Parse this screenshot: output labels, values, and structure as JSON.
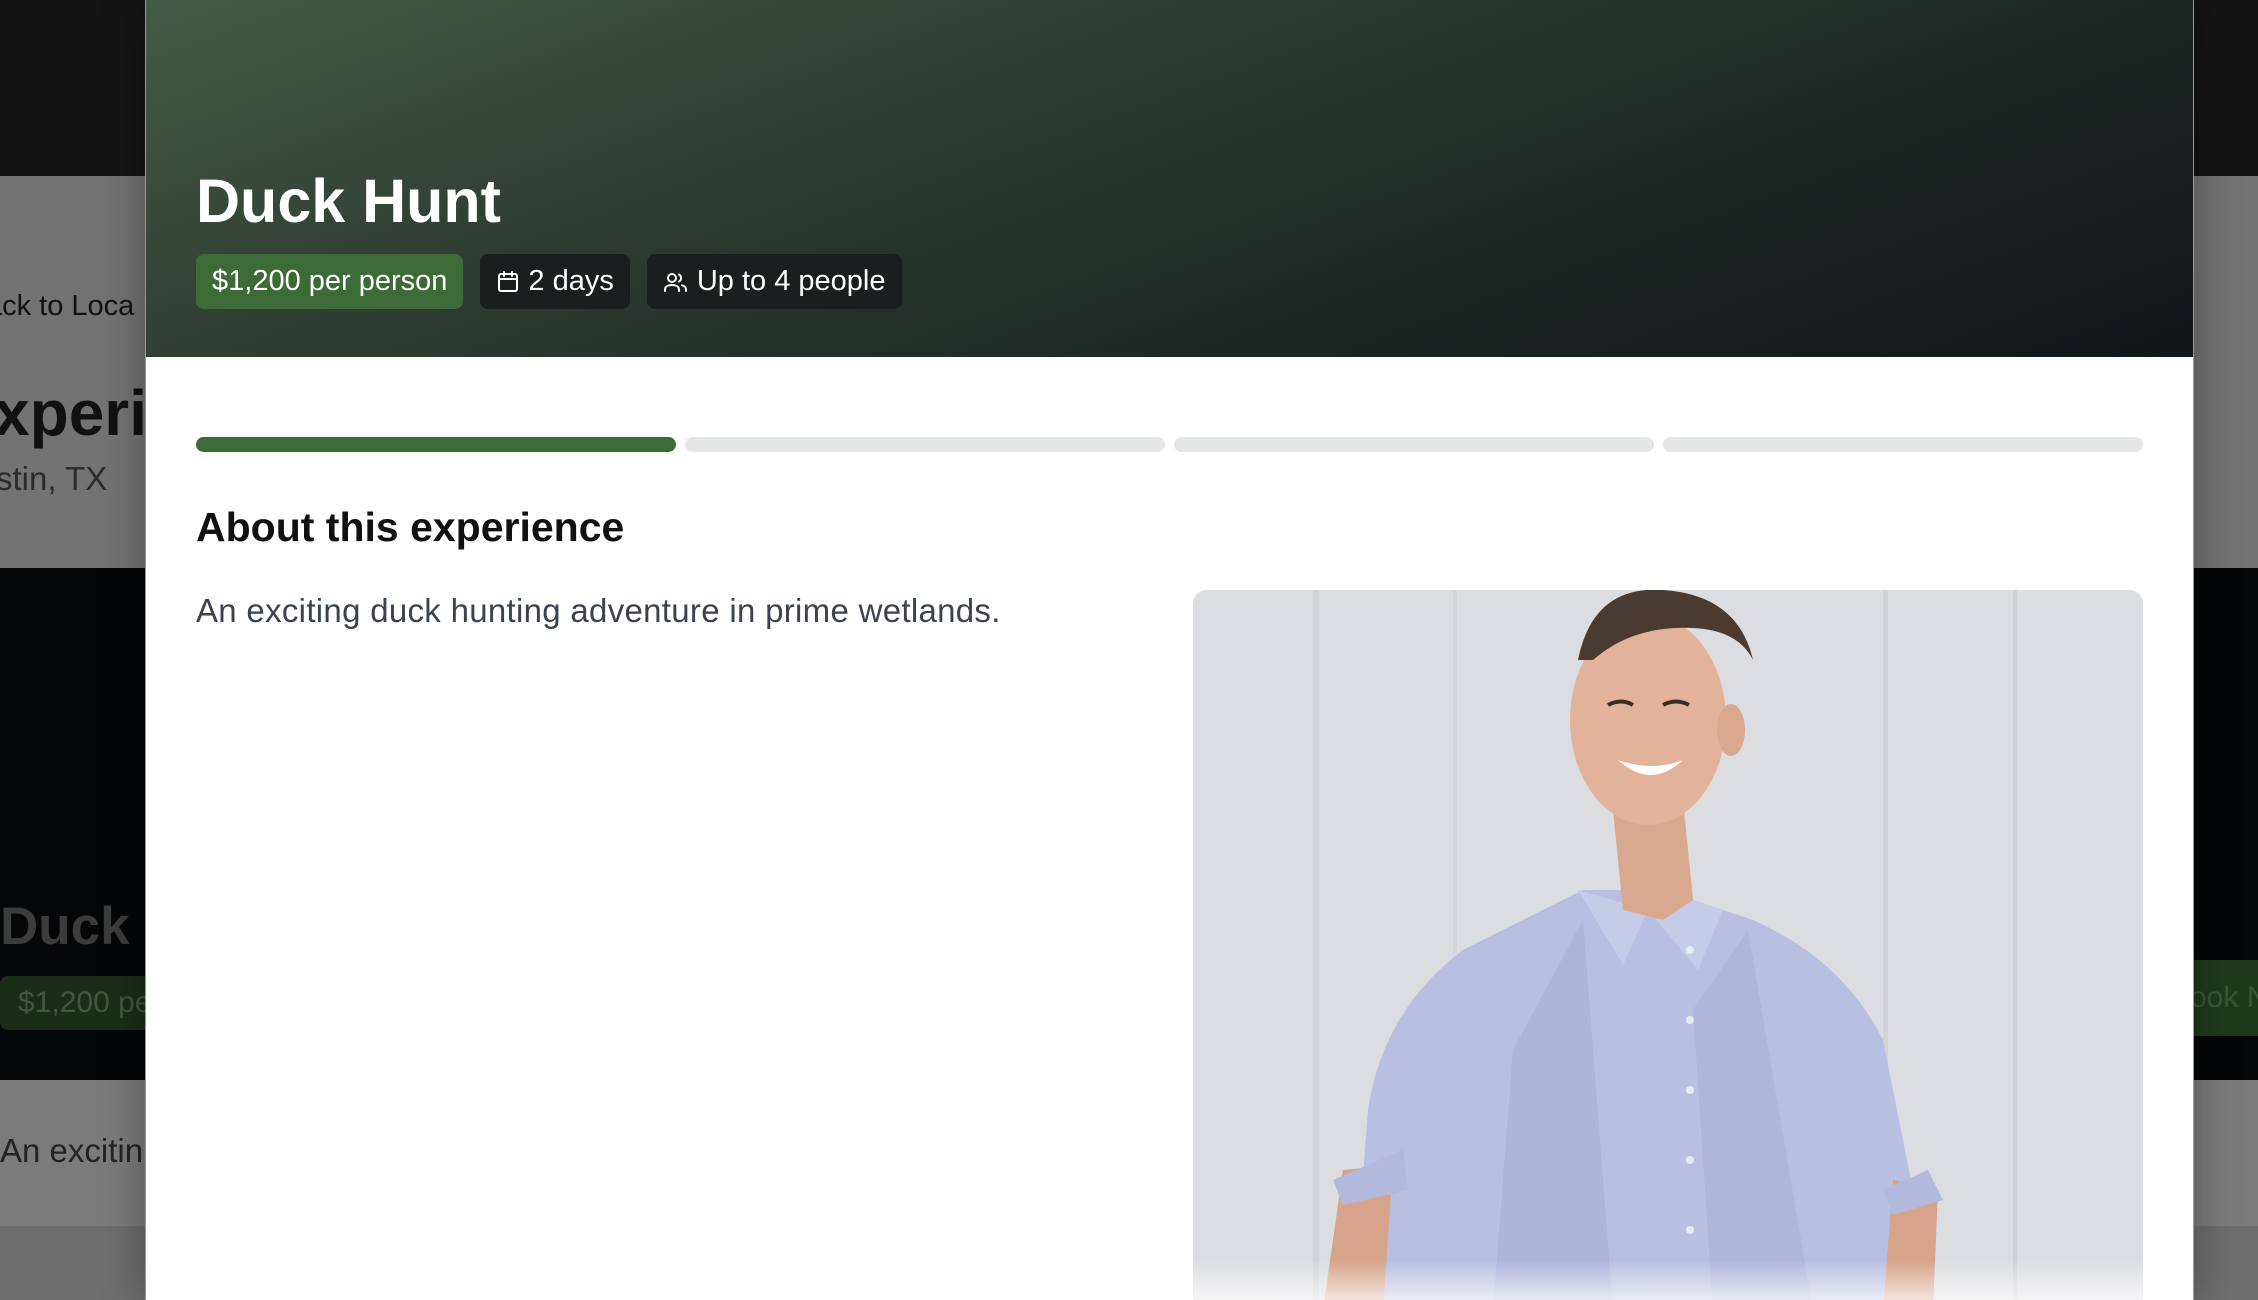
{
  "background_page": {
    "back_link": "ack to Loca",
    "title": "xperie",
    "location": "stin, TX",
    "hero_title": "Duck H",
    "hero_price": "$1,200 pe",
    "book_button": "ook N",
    "description": "An excitin"
  },
  "modal": {
    "title": "Duck Hunt",
    "price_chip": "$1,200 per person",
    "duration_chip": "2 days",
    "capacity_chip": "Up to 4 people",
    "progress": {
      "total_steps": 4,
      "current_step": 1
    },
    "section_title": "About this experience",
    "description": "An exciting duck hunting adventure in prime wetlands.",
    "icons": {
      "duration": "calendar-icon",
      "capacity": "users-icon"
    }
  },
  "colors": {
    "accent_green": "#3d6b38",
    "progress_inactive": "#e4e6e8",
    "chip_dark": "#1a1e1f",
    "hero_dark": "#121618"
  }
}
